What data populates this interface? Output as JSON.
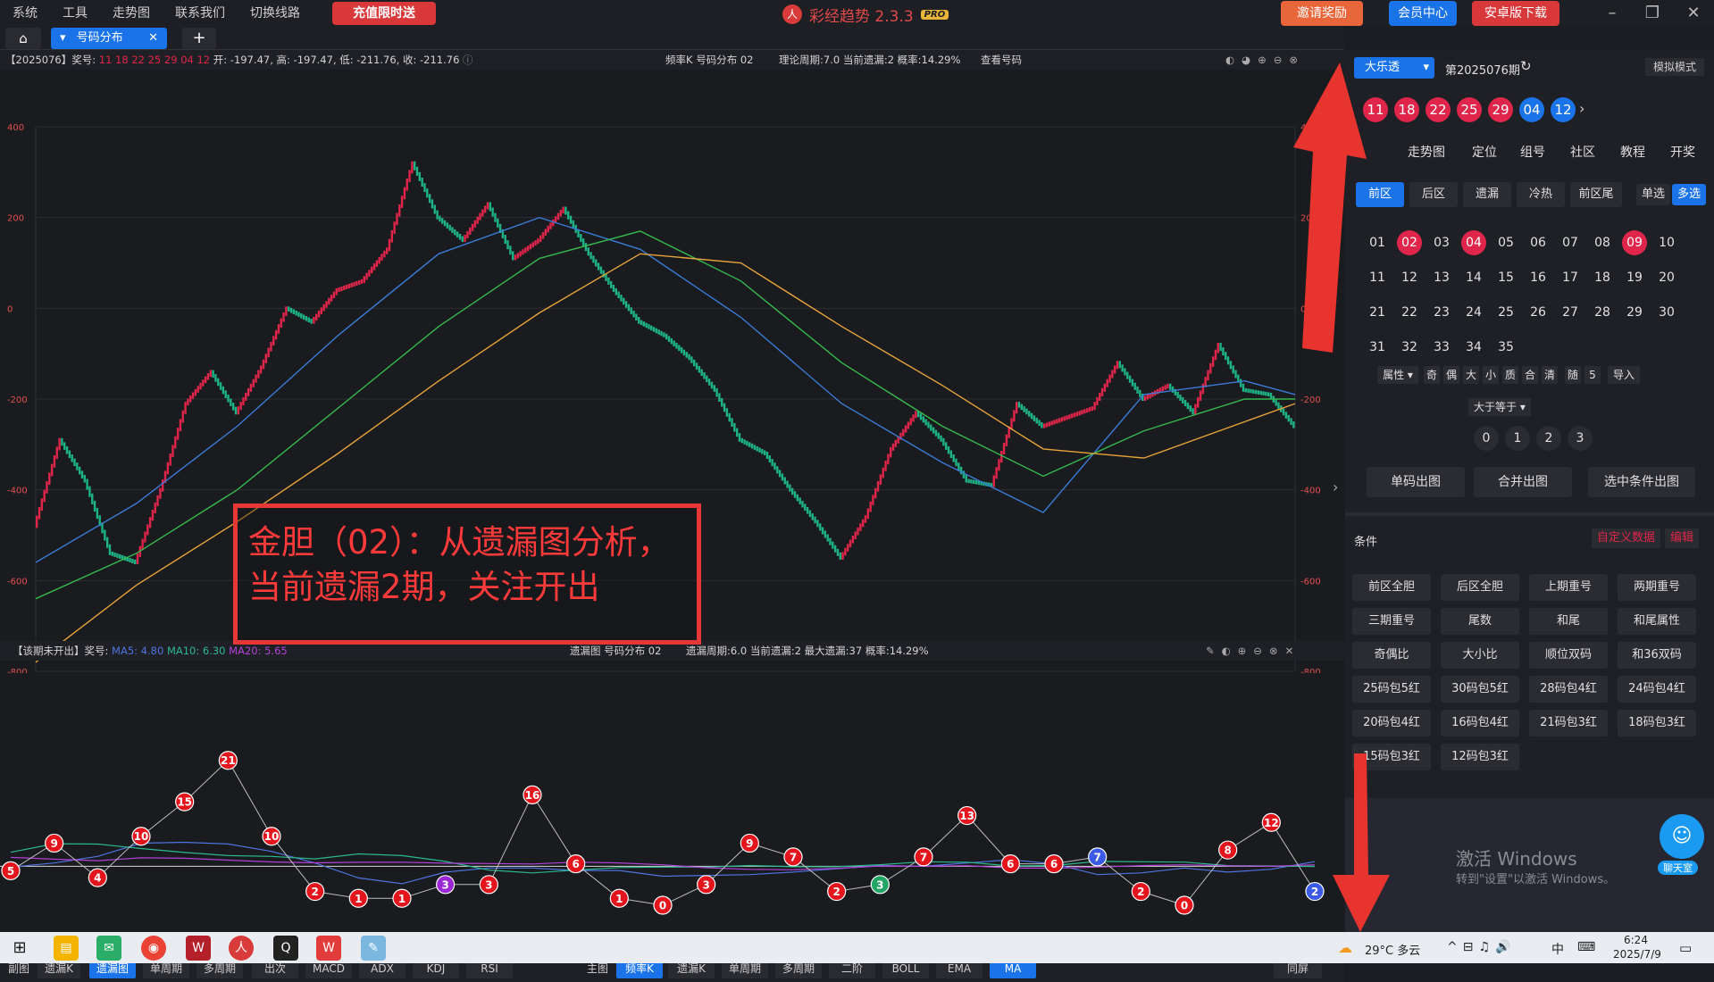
{
  "menu": {
    "items": [
      "系统",
      "工具",
      "走势图",
      "联系我们",
      "切换线路"
    ],
    "recharge": "充值限时送"
  },
  "brand": {
    "name": "彩经趋势 2.3.3",
    "badge": "PRO"
  },
  "topbuttons": {
    "invite": "邀请奖励",
    "member": "会员中心",
    "android": "安卓版下载"
  },
  "tabs": {
    "home": "⌂",
    "active": "号码分布",
    "add": "+"
  },
  "upper_info": {
    "left": "【2025076】奖号:",
    "prize": "11 18 22 25 29 04 12",
    "ohlc": "开: -197.47, 高: -197.47, 低: -211.76, 收: -211.76",
    "mid": "频率K  号码分布  02",
    "stats": "理论周期:7.0  当前遗漏:2  概率:14.29%",
    "view": "查看号码"
  },
  "lower_info": {
    "left": "【该期未开出】奖号:",
    "ma5": "MA5: 4.80",
    "ma10": "MA10: 6.30",
    "ma20": "MA20: 5.65",
    "mid": "遗漏图  号码分布  02",
    "stats": "遗漏周期:6.0  当前遗漏:2  最大遗漏:37  概率:14.29%"
  },
  "annotation": {
    "line1": "金胆（02）：从遗漏图分析，",
    "line2": "当前遗漏2期，关注开出"
  },
  "chart_data": [
    {
      "type": "line",
      "title": "",
      "ylim": [
        -800,
        400
      ],
      "yticks": [
        "400",
        "200",
        "0",
        "-200",
        "-400",
        "-600",
        "-800"
      ],
      "series": [
        {
          "name": "",
          "color": "#1db386",
          "x": [
            0,
            5,
            10,
            15,
            20,
            25,
            30,
            35,
            40,
            45,
            50,
            55,
            60,
            65,
            70,
            75,
            80,
            85,
            90,
            95,
            100,
            105,
            110,
            115,
            120,
            125,
            130,
            135,
            140,
            145,
            150,
            155,
            160,
            165,
            170,
            175,
            180,
            185,
            190,
            195,
            200,
            205,
            210,
            215,
            220,
            225,
            230,
            235,
            240,
            245,
            250
          ],
          "values": [
            -480,
            -290,
            -380,
            -540,
            -560,
            -400,
            -210,
            -140,
            -230,
            -130,
            0,
            -30,
            40,
            60,
            130,
            320,
            200,
            150,
            230,
            110,
            150,
            220,
            120,
            40,
            -30,
            -60,
            -110,
            -180,
            -290,
            -320,
            -400,
            -470,
            -550,
            -460,
            -310,
            -230,
            -290,
            -380,
            -390,
            -210,
            -260,
            -240,
            -220,
            -120,
            -200,
            -170,
            -230,
            -80,
            -180,
            -190,
            -260
          ]
        },
        {
          "name": "",
          "color": "#3a7bd5",
          "x": [
            0,
            20,
            40,
            60,
            80,
            100,
            120,
            140,
            160,
            180,
            200,
            220,
            240,
            250
          ],
          "values": [
            -560,
            -430,
            -260,
            -60,
            120,
            200,
            130,
            -20,
            -210,
            -340,
            -450,
            -190,
            -160,
            -190
          ]
        },
        {
          "name": "",
          "color": "#35b84d",
          "x": [
            0,
            20,
            40,
            60,
            80,
            100,
            120,
            140,
            160,
            180,
            200,
            220,
            240,
            250
          ],
          "values": [
            -640,
            -540,
            -400,
            -220,
            -40,
            110,
            170,
            60,
            -120,
            -260,
            -370,
            -270,
            -200,
            -200
          ]
        },
        {
          "name": "",
          "color": "#e6a33a",
          "x": [
            0,
            20,
            40,
            60,
            80,
            100,
            120,
            140,
            160,
            180,
            200,
            220,
            240,
            250
          ],
          "values": [
            -780,
            -610,
            -470,
            -320,
            -160,
            -10,
            120,
            100,
            -40,
            -170,
            -310,
            -330,
            -250,
            -210
          ]
        }
      ]
    },
    {
      "type": "line",
      "title": "",
      "points": [
        {
          "x": 0,
          "y": 5
        },
        {
          "x": 1,
          "y": 9
        },
        {
          "x": 2,
          "y": 4
        },
        {
          "x": 3,
          "y": 10
        },
        {
          "x": 4,
          "y": 15
        },
        {
          "x": 5,
          "y": 21
        },
        {
          "x": 6,
          "y": 10
        },
        {
          "x": 7,
          "y": 2
        },
        {
          "x": 8,
          "y": 1
        },
        {
          "x": 9,
          "y": 1
        },
        {
          "x": 10,
          "y": 3
        },
        {
          "x": 11,
          "y": 3
        },
        {
          "x": 12,
          "y": 16
        },
        {
          "x": 13,
          "y": 6
        },
        {
          "x": 14,
          "y": 1
        },
        {
          "x": 15,
          "y": 0
        },
        {
          "x": 16,
          "y": 3
        },
        {
          "x": 17,
          "y": 9
        },
        {
          "x": 18,
          "y": 7
        },
        {
          "x": 19,
          "y": 2
        },
        {
          "x": 20,
          "y": 3
        },
        {
          "x": 21,
          "y": 7
        },
        {
          "x": 22,
          "y": 13
        },
        {
          "x": 23,
          "y": 6
        },
        {
          "x": 24,
          "y": 6
        },
        {
          "x": 25,
          "y": 7
        },
        {
          "x": 26,
          "y": 2
        },
        {
          "x": 27,
          "y": 0
        },
        {
          "x": 28,
          "y": 8
        },
        {
          "x": 29,
          "y": 12
        },
        {
          "x": 30,
          "y": 2
        }
      ],
      "ma5": 4.8,
      "ma10": 6.3,
      "ma20": 5.65
    }
  ],
  "bottom": {
    "sub_label": "副图",
    "sub": [
      "遗漏K",
      "遗漏图",
      "单周期",
      "多周期",
      "出次",
      "MACD",
      "ADX",
      "KDJ",
      "RSI"
    ],
    "main_label": "主图",
    "main": [
      "频率K",
      "遗漏K",
      "单周期",
      "多周期",
      "二阶",
      "BOLL",
      "EMA",
      "MA"
    ],
    "sync": "同屏"
  },
  "right": {
    "lottery": "大乐透",
    "period": "第2025076期",
    "mode": "模拟模式",
    "balls": [
      "11",
      "18",
      "22",
      "25",
      "29",
      "04",
      "12"
    ],
    "tabs": [
      "走势图",
      "定位",
      "组号",
      "社区",
      "教程",
      "开奖"
    ],
    "segments": [
      "前区",
      "后区",
      "遗漏",
      "冷热",
      "前区尾"
    ],
    "single": "单选",
    "multi": "多选",
    "numbers": [
      "01",
      "02",
      "03",
      "04",
      "05",
      "06",
      "07",
      "08",
      "09",
      "10",
      "11",
      "12",
      "13",
      "14",
      "15",
      "16",
      "17",
      "18",
      "19",
      "20",
      "21",
      "22",
      "23",
      "24",
      "25",
      "26",
      "27",
      "28",
      "29",
      "30",
      "31",
      "32",
      "33",
      "34",
      "35"
    ],
    "selected": [
      "02",
      "04",
      "09"
    ],
    "tools": [
      "属性",
      "奇",
      "偶",
      "大",
      "小",
      "质",
      "合",
      "清",
      "随",
      "5",
      "导入"
    ],
    "compare": "大于等于",
    "digits": [
      "0",
      "1",
      "2",
      "3"
    ],
    "outs": [
      "单码出图",
      "合并出图",
      "选中条件出图"
    ],
    "cond_title": "条件",
    "custom": "自定义数据",
    "edit": "编辑",
    "conditions": [
      "前区全胆",
      "后区全胆",
      "上期重号",
      "两期重号",
      "三期重号",
      "尾数",
      "和尾",
      "和尾属性",
      "奇偶比",
      "大小比",
      "顺位双码",
      "和36双码",
      "25码包5红",
      "30码包5红",
      "28码包4红",
      "24码包4红",
      "20码包4红",
      "16码包4红",
      "21码包3红",
      "18码包3红",
      "15码包3红",
      "12码包3红"
    ],
    "watermark1": "激活 Windows",
    "watermark2": "转到\"设置\"以激活 Windows。",
    "chat": "聊天室"
  },
  "taskbar": {
    "weather": "29°C  多云",
    "time": "6:24",
    "date": "2025/7/9",
    "ime": "中"
  }
}
